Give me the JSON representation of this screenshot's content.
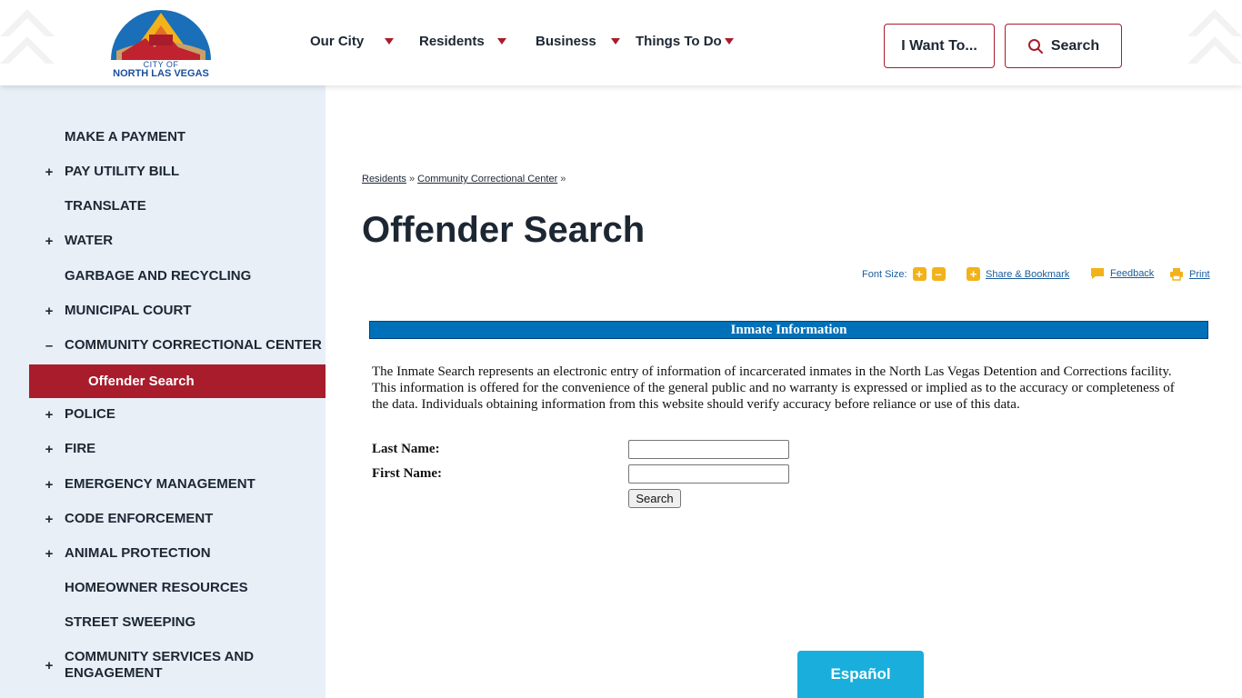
{
  "header": {
    "logo": {
      "line1": "CITY OF",
      "line2": "NORTH LAS VEGAS"
    },
    "nav": [
      {
        "label": "Our City"
      },
      {
        "label": "Residents"
      },
      {
        "label": "Business"
      },
      {
        "label": "Things To Do"
      }
    ],
    "i_want_to_label": "I Want To...",
    "search_label": "Search"
  },
  "sidebar": {
    "items": [
      {
        "label": "MAKE A PAYMENT",
        "toggle": ""
      },
      {
        "label": "PAY UTILITY BILL",
        "toggle": "+"
      },
      {
        "label": "TRANSLATE",
        "toggle": ""
      },
      {
        "label": "WATER",
        "toggle": "+"
      },
      {
        "label": "GARBAGE AND RECYCLING",
        "toggle": ""
      },
      {
        "label": "MUNICIPAL COURT",
        "toggle": "+"
      },
      {
        "label": "COMMUNITY CORRECTIONAL CENTER",
        "toggle": "–"
      },
      {
        "label": "Offender Search",
        "toggle": ""
      },
      {
        "label": "POLICE",
        "toggle": "+"
      },
      {
        "label": "FIRE",
        "toggle": "+"
      },
      {
        "label": "EMERGENCY MANAGEMENT",
        "toggle": "+"
      },
      {
        "label": "CODE ENFORCEMENT",
        "toggle": "+"
      },
      {
        "label": "ANIMAL PROTECTION",
        "toggle": "+"
      },
      {
        "label": "HOMEOWNER RESOURCES",
        "toggle": ""
      },
      {
        "label": "STREET SWEEPING",
        "toggle": ""
      },
      {
        "label": "COMMUNITY SERVICES AND ENGAGEMENT",
        "toggle": "+"
      }
    ]
  },
  "breadcrumb": {
    "items": [
      "Residents",
      "Community Correctional Center"
    ],
    "separator": "»"
  },
  "page_title": "Offender Search",
  "tools": {
    "font_size_label": "Font Size:",
    "increase": "+",
    "decrease": "–",
    "share_label": "Share & Bookmark",
    "feedback_label": "Feedback",
    "print_label": "Print"
  },
  "inmate": {
    "header": "Inmate Information",
    "disclaimer": "The Inmate Search represents an electronic entry of information of incarcerated inmates in the North Las Vegas Detention and Corrections facility. This information is offered for the convenience of the general public and no warranty is expressed or implied as to the accuracy or completeness of the data. Individuals obtaining information from this website should verify accuracy before reliance or use of this data.",
    "last_name_label": "Last Name:",
    "last_name_value": "",
    "first_name_label": "First Name:",
    "first_name_value": "",
    "search_button": "Search"
  },
  "espanol_label": "Español",
  "colors": {
    "brand_red": "#a81c2c",
    "brand_blue": "#0070b8",
    "sidebar_bg": "#e8eff7",
    "accent_yellow": "#f2b21a",
    "espanol_bg": "#1aaedc"
  }
}
